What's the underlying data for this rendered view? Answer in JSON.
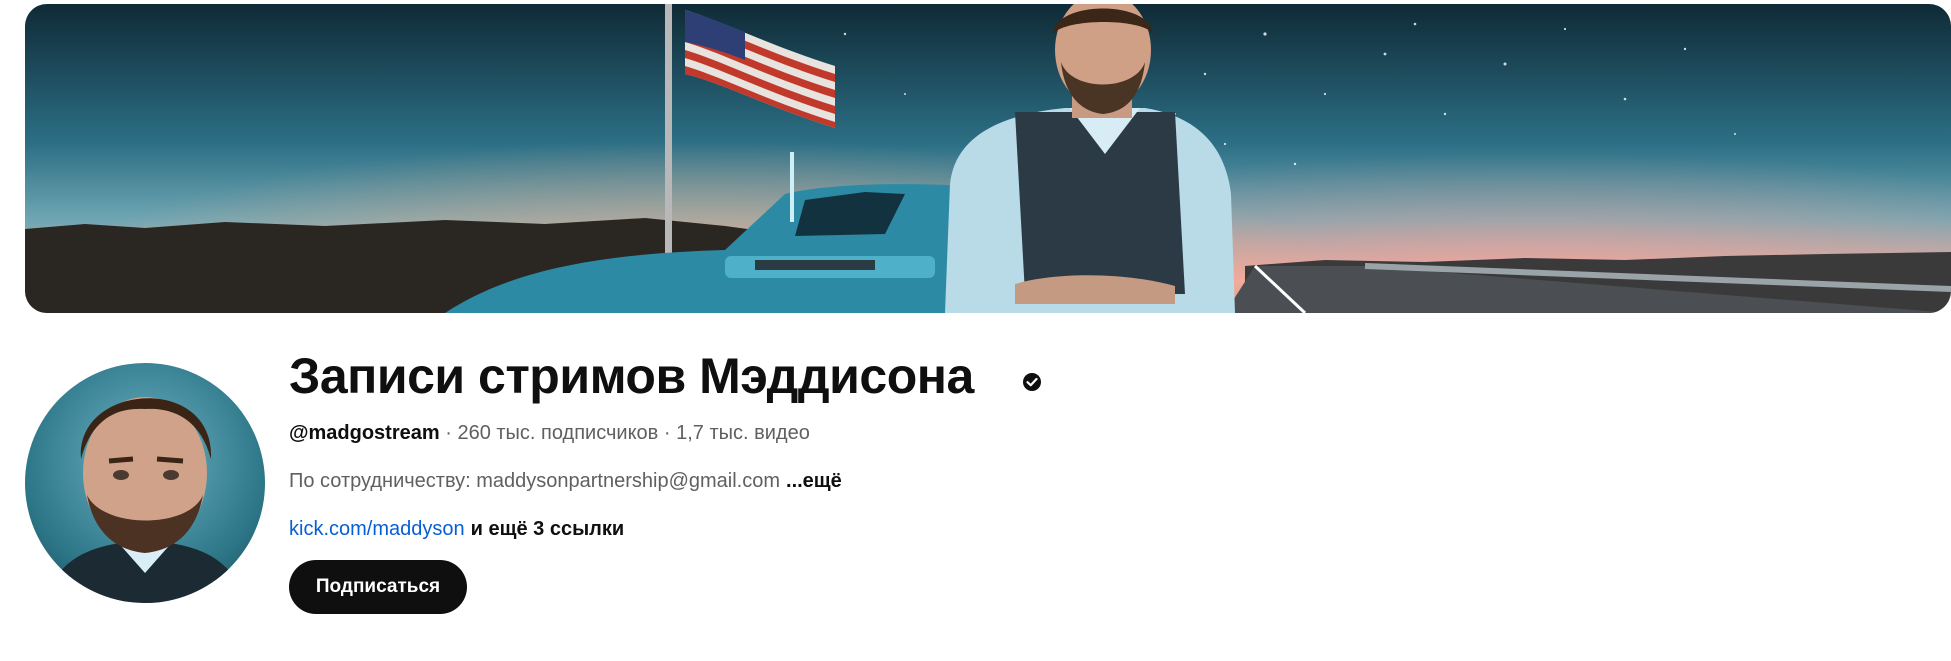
{
  "channel": {
    "title": "Записи стримов Мэддисона",
    "verified_icon": "verified-check-icon",
    "handle": "@madgostream",
    "separator": "·",
    "subscribers": "260 тыс. подписчиков",
    "videos": "1,7 тыс. видео",
    "description": "По сотрудничеству: maddysonpartnership@gmail.com",
    "description_more": "...ещё",
    "link_text": "kick.com/maddyson",
    "more_links": "и ещё 3 ссылки",
    "subscribe_label": "Подписаться"
  },
  "colors": {
    "link": "#065fd4",
    "subscribe_bg": "#0f0f0f",
    "muted_text": "#606060"
  }
}
